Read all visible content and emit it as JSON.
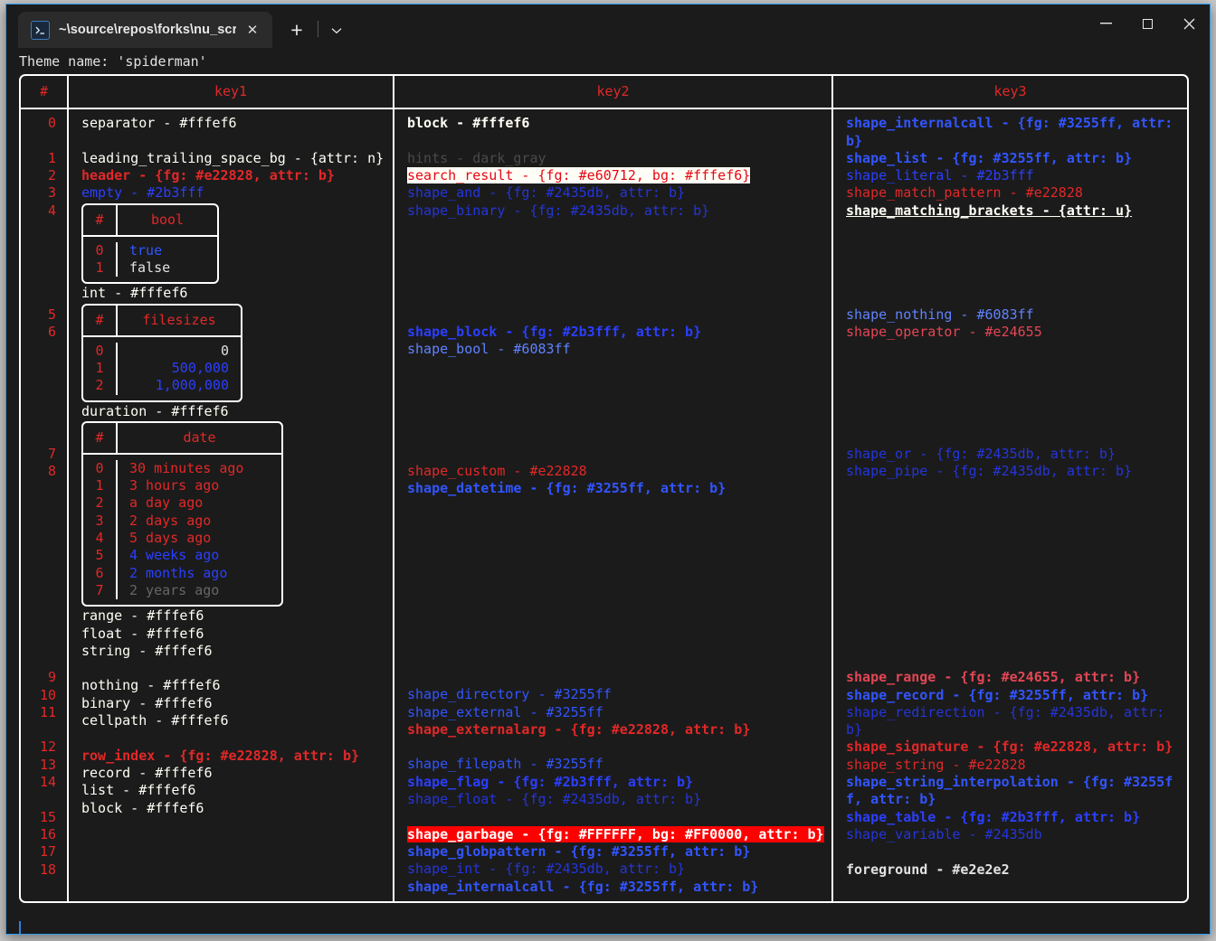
{
  "window": {
    "tab": {
      "icon": "terminal-icon",
      "title": "~\\source\\repos\\forks\\nu_scrip",
      "close": "✕"
    },
    "new_tab": "+",
    "dropdown": "⌄",
    "controls": {
      "minimize": "—",
      "maximize": "□",
      "close": "✕"
    }
  },
  "terminal": {
    "theme_line": "Theme name: 'spiderman'",
    "prompt": ""
  },
  "table": {
    "headers": {
      "index": "#",
      "key1": "key1",
      "key2": "key2",
      "key3": "key3"
    },
    "row_numbers": [
      "0",
      "1",
      "2",
      "3",
      "4",
      "5",
      "6",
      "7",
      "8",
      "9",
      "10",
      "11",
      "12",
      "13",
      "14",
      "15",
      "16",
      "17",
      "18"
    ],
    "key1": [
      "separator - #fffef6",
      "leading_trailing_space_bg - {attr: n}",
      "header - {fg: #e22828, attr: b}",
      "empty - #2b3fff",
      "int - #fffef6",
      "duration - #fffef6",
      "range - #fffef6",
      "float - #fffef6",
      "string - #fffef6",
      "nothing - #fffef6",
      "binary - #fffef6",
      "cellpath - #fffef6",
      "row_index - {fg: #e22828, attr: b}",
      "record - #fffef6",
      "list - #fffef6",
      "block - #fffef6"
    ],
    "key2": [
      "block - #fffef6",
      "hints - dark_gray",
      "search_result - {fg: #e60712, bg: #fffef6}",
      "shape_and - {fg: #2435db, attr: b}",
      "shape_binary - {fg: #2435db, attr: b}",
      "shape_block - {fg: #2b3fff, attr: b}",
      "shape_bool - #6083ff",
      "shape_custom - #e22828",
      "shape_datetime - {fg: #3255ff, attr: b}",
      "shape_directory - #3255ff",
      "shape_external - #3255ff",
      "shape_externalarg - {fg: #e22828, attr: b}",
      "shape_filepath - #3255ff",
      "shape_flag - {fg: #2b3fff, attr: b}",
      "shape_float - {fg: #2435db, attr: b}",
      "shape_garbage - {fg: #FFFFFF, bg: #FF0000, attr: b}",
      "shape_globpattern - {fg: #3255ff, attr: b}",
      "shape_int - {fg: #2435db, attr: b}",
      "shape_internalcall - {fg: #3255ff, attr: b}"
    ],
    "key3": [
      "shape_internalcall - {fg: #3255ff, attr: b}",
      "shape_list - {fg: #3255ff, attr: b}",
      "shape_literal - #2b3fff",
      "shape_match_pattern - #e22828",
      "shape_matching_brackets - {attr: u}",
      "shape_nothing - #6083ff",
      "shape_operator - #e24655",
      "shape_or - {fg: #2435db, attr: b}",
      "shape_pipe - {fg: #2435db, attr: b}",
      "shape_range - {fg: #e24655, attr: b}",
      "shape_record - {fg: #3255ff, attr: b}",
      "shape_redirection - {fg: #2435db, attr: b}",
      "shape_signature - {fg: #e22828, attr: b}",
      "shape_string - #e22828",
      "shape_string_interpolation - {fg: #3255ff, attr: b}",
      "shape_table - {fg: #2b3fff, attr: b}",
      "shape_variable - #2435db",
      "foreground - #e2e2e2"
    ]
  },
  "nested_tables": {
    "bool": {
      "header_index": "#",
      "header_col": "bool",
      "rows": [
        {
          "index": "0",
          "value": "true"
        },
        {
          "index": "1",
          "value": "false"
        }
      ]
    },
    "filesizes": {
      "header_index": "#",
      "header_col": "filesizes",
      "rows": [
        {
          "index": "0",
          "value": "0"
        },
        {
          "index": "1",
          "value": "500,000"
        },
        {
          "index": "2",
          "value": "1,000,000"
        }
      ]
    },
    "date": {
      "header_index": "#",
      "header_col": "date",
      "rows": [
        {
          "index": "0",
          "value": "30 minutes ago"
        },
        {
          "index": "1",
          "value": "3 hours ago"
        },
        {
          "index": "2",
          "value": "a day ago"
        },
        {
          "index": "3",
          "value": "2 days ago"
        },
        {
          "index": "4",
          "value": "5 days ago"
        },
        {
          "index": "5",
          "value": "4 weeks ago"
        },
        {
          "index": "6",
          "value": "2 months ago"
        },
        {
          "index": "7",
          "value": "2 years ago"
        }
      ]
    }
  },
  "colors": {
    "accent": "#2f9bef",
    "header_red": "#e22828",
    "white_fg": "#fffef6",
    "blue": "#3255ff",
    "highlight_bg": "#ff0000"
  }
}
